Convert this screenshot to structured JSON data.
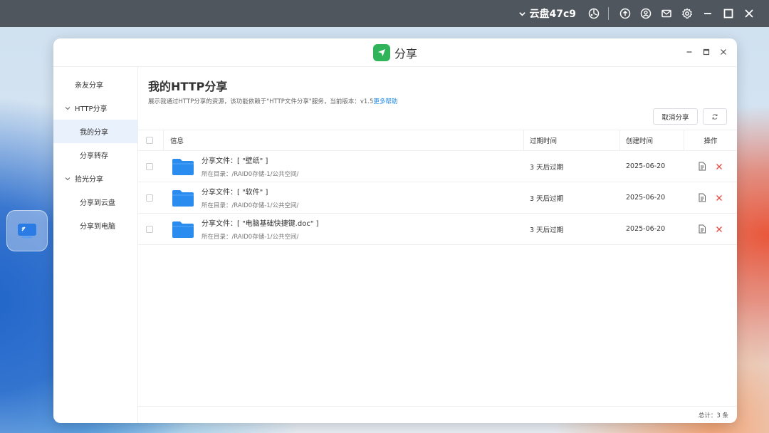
{
  "topbar": {
    "user_label": "云盘47c9",
    "icons": [
      "chevron-down-icon",
      "dashboard-icon",
      "upload-icon",
      "user-icon",
      "mail-icon",
      "gear-icon",
      "minimize-icon",
      "maximize-icon",
      "close-icon"
    ]
  },
  "desktop": {
    "icon": "remote-desktop-icon"
  },
  "window": {
    "app_name": "分享",
    "app_color": "#2fb45a"
  },
  "sidebar": {
    "items": [
      {
        "label": "亲友分享",
        "kind": "top"
      },
      {
        "label": "HTTP分享",
        "kind": "group"
      },
      {
        "label": "我的分享",
        "kind": "sub",
        "active": true
      },
      {
        "label": "分享转存",
        "kind": "sub"
      },
      {
        "label": "拾光分享",
        "kind": "group"
      },
      {
        "label": "分享到云盘",
        "kind": "sub"
      },
      {
        "label": "分享到电脑",
        "kind": "sub"
      }
    ]
  },
  "main": {
    "title": "我的HTTP分享",
    "description": "展示我通过HTTP分享的资源，该功能依赖于\"HTTP文件分享\"服务，当前版本：v1.5",
    "help_link": "更多帮助",
    "cancel_share_label": "取消分享",
    "columns": {
      "info": "信息",
      "expire": "过期时间",
      "created": "创建时间",
      "ops": "操作"
    },
    "rows": [
      {
        "name": "分享文件：[ \"壁纸\" ]",
        "path": "所在目录：/RAID0存储-1/公共空间/",
        "expire": "3 天后过期",
        "created": "2025-06-20"
      },
      {
        "name": "分享文件：[ \"软件\" ]",
        "path": "所在目录：/RAID0存储-1/公共空间/",
        "expire": "3 天后过期",
        "created": "2025-06-20"
      },
      {
        "name": "分享文件：[ \"电脑基础快捷键.doc\" ]",
        "path": "所在目录：/RAID0存储-1/公共空间/",
        "expire": "3 天后过期",
        "created": "2025-06-20"
      }
    ],
    "footer_total": "总计：3 条"
  },
  "colors": {
    "accent": "#1e88e5",
    "folder": "#2b8cf0",
    "delete": "#e5483c",
    "topbar": "#4f565e"
  }
}
